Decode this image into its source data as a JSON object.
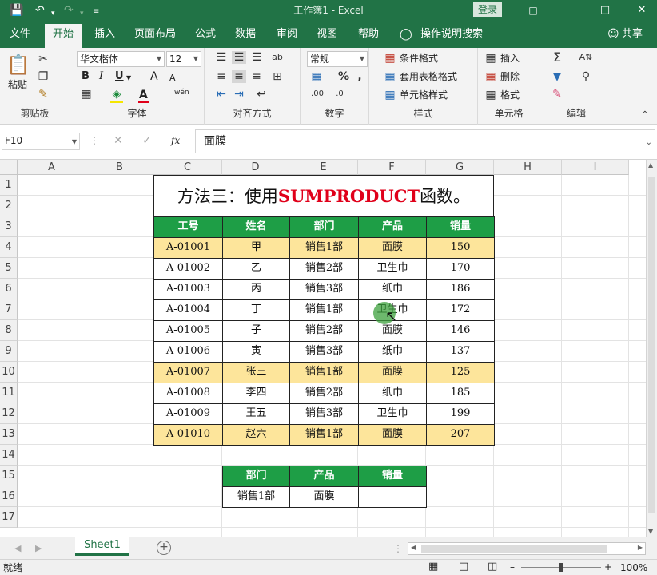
{
  "titlebar": {
    "title": "工作簿1  -  Excel",
    "login": "登录",
    "save_icon": "save-icon",
    "undo_icon": "undo-icon",
    "redo_icon": "redo-icon"
  },
  "menu": {
    "tabs": [
      "文件",
      "开始",
      "插入",
      "页面布局",
      "公式",
      "数据",
      "审阅",
      "视图",
      "帮助"
    ],
    "active": "开始",
    "tell_me": "操作说明搜索",
    "share": "共享"
  },
  "ribbon": {
    "clipboard": {
      "label": "剪贴板",
      "paste": "粘贴"
    },
    "font": {
      "label": "字体",
      "name": "华文楷体",
      "size": "12",
      "bold": "B",
      "italic": "I",
      "underline": "U",
      "grow": "A",
      "shrink": "A",
      "phonetic": "wén"
    },
    "alignment": {
      "label": "对齐方式"
    },
    "number": {
      "label": "数字",
      "format": "常规"
    },
    "styles": {
      "label": "样式",
      "conditional": "条件格式",
      "table": "套用表格格式",
      "cell": "单元格样式"
    },
    "cells": {
      "label": "单元格",
      "insert": "插入",
      "delete": "删除",
      "format": "格式"
    },
    "editing": {
      "label": "编辑"
    }
  },
  "formula": {
    "namebox": "F10",
    "fx": "fx",
    "value": "面膜"
  },
  "columns": [
    "A",
    "B",
    "C",
    "D",
    "E",
    "F",
    "G",
    "H",
    "I"
  ],
  "rows": [
    "1",
    "2",
    "3",
    "4",
    "5",
    "6",
    "7",
    "8",
    "9",
    "10",
    "11",
    "12",
    "13",
    "14",
    "15",
    "16",
    "17"
  ],
  "sheet": {
    "title_prefix": "方法三：使用",
    "title_highlight": "SUMPRODUCT",
    "title_suffix": "函数。",
    "headers": [
      "工号",
      "姓名",
      "部门",
      "产品",
      "销量"
    ],
    "rows": [
      [
        "A-01001",
        "甲",
        "销售1部",
        "面膜",
        "150"
      ],
      [
        "A-01002",
        "乙",
        "销售2部",
        "卫生巾",
        "170"
      ],
      [
        "A-01003",
        "丙",
        "销售3部",
        "纸巾",
        "186"
      ],
      [
        "A-01004",
        "丁",
        "销售1部",
        "卫生巾",
        "172"
      ],
      [
        "A-01005",
        "子",
        "销售2部",
        "面膜",
        "146"
      ],
      [
        "A-01006",
        "寅",
        "销售3部",
        "纸巾",
        "137"
      ],
      [
        "A-01007",
        "张三",
        "销售1部",
        "面膜",
        "125"
      ],
      [
        "A-01008",
        "李四",
        "销售2部",
        "纸巾",
        "185"
      ],
      [
        "A-01009",
        "王五",
        "销售3部",
        "卫生巾",
        "199"
      ],
      [
        "A-01010",
        "赵六",
        "销售1部",
        "面膜",
        "207"
      ]
    ],
    "highlight_rows": [
      0,
      6,
      9
    ],
    "lookup_headers": [
      "部门",
      "产品",
      "销量"
    ],
    "lookup_values": [
      "销售1部",
      "面膜",
      ""
    ]
  },
  "tabs": {
    "sheet1": "Sheet1",
    "add": "+"
  },
  "status": {
    "ready": "就绪",
    "zoom": "100%"
  },
  "colors": {
    "accent": "#217346",
    "header_green": "#1e9e46",
    "highlight": "#fde59b",
    "title_red": "#e0001a"
  }
}
